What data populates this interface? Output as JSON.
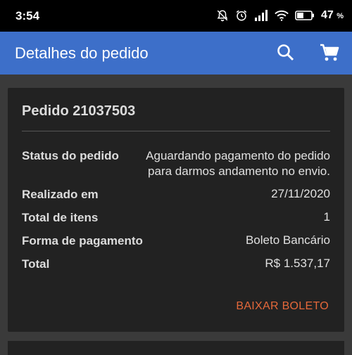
{
  "status_bar": {
    "time": "3:54",
    "battery_percent": "47",
    "battery_unit": "%",
    "battery_level": 0.47,
    "icons": [
      "notifications-off-icon",
      "alarm-icon",
      "signal-icon",
      "wifi-icon",
      "battery-icon"
    ]
  },
  "app_bar": {
    "title": "Detalhes do pedido",
    "background": "#3d6fc9",
    "icons": [
      "search-icon",
      "cart-icon"
    ]
  },
  "order": {
    "title": "Pedido 21037503",
    "rows": [
      {
        "label": "Status do pedido",
        "value_line1": "Aguardando pagamento do pedido",
        "value_line2": "para darmos andamento no envio."
      },
      {
        "label": "Realizado em",
        "value": "27/11/2020"
      },
      {
        "label": "Total de itens",
        "value": "1"
      },
      {
        "label": "Forma de pagamento",
        "value": "Boleto Bancário"
      },
      {
        "label": "Total",
        "value": "R$ 1.537,17"
      }
    ],
    "action_label": "BAIXAR BOLETO",
    "action_color": "#e4683a"
  }
}
